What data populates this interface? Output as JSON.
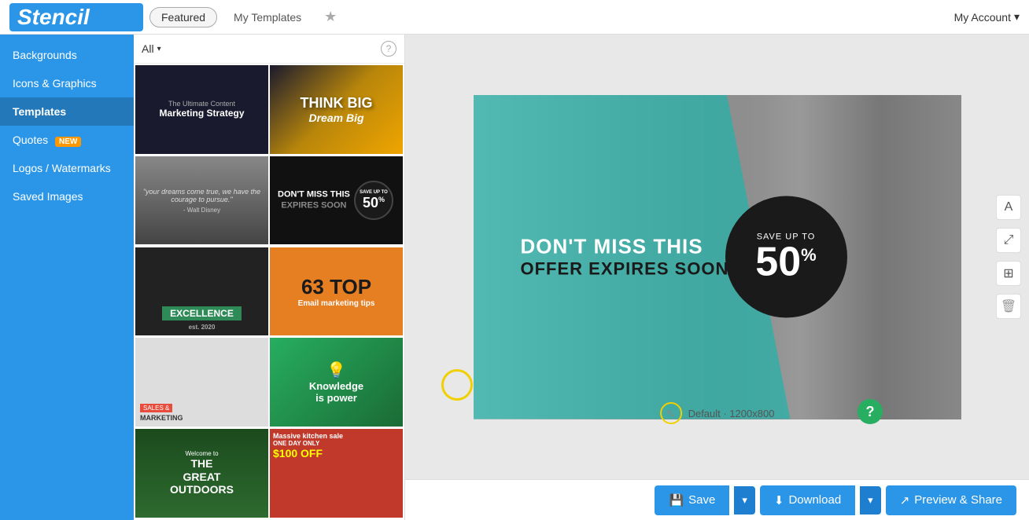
{
  "app": {
    "logo": "Stencil",
    "myAccount": "My Account"
  },
  "topTabs": {
    "featured": "Featured",
    "myTemplates": "My Templates"
  },
  "sidebar": {
    "items": [
      {
        "id": "backgrounds",
        "label": "Backgrounds",
        "badge": null
      },
      {
        "id": "icons-graphics",
        "label": "Icons & Graphics",
        "badge": null
      },
      {
        "id": "templates",
        "label": "Templates",
        "badge": null
      },
      {
        "id": "quotes",
        "label": "Quotes",
        "badge": "NEW"
      },
      {
        "id": "logos-watermarks",
        "label": "Logos / Watermarks",
        "badge": null
      },
      {
        "id": "saved-images",
        "label": "Saved Images",
        "badge": null
      }
    ]
  },
  "panel": {
    "filterLabel": "All",
    "templates": [
      {
        "id": 1,
        "label": "The Ultimate Content Marketing Strategy"
      },
      {
        "id": 2,
        "label": "THINK BIG Dream Big"
      },
      {
        "id": 3,
        "label": "Walt Disney quote"
      },
      {
        "id": 4,
        "label": "Don't Miss This Expires Soon 50%"
      },
      {
        "id": 5,
        "label": "Excellence"
      },
      {
        "id": 6,
        "label": "63 TOP Email marketing tips"
      },
      {
        "id": 7,
        "label": "Sales & Marketing Course"
      },
      {
        "id": 8,
        "label": "Knowledge is power"
      },
      {
        "id": 9,
        "label": "Welcome to the Great Outdoors"
      },
      {
        "id": 10,
        "label": "Massive kitchen sale ONE DAY ONLY"
      }
    ]
  },
  "canvas": {
    "mainTextLine1": "DON'T MISS THIS",
    "mainTextLine2": "OFFER EXPIRES SOON",
    "saveUpTo": "SAVE UP TO",
    "percent": "50",
    "percentSymbol": "%",
    "sizeLabel": "Default · 1200x800"
  },
  "bottomToolbar": {
    "saveLabel": "Save",
    "downloadLabel": "Download",
    "previewLabel": "Preview & Share"
  },
  "icons": {
    "star": "★",
    "chevronDown": "▾",
    "help": "?",
    "text": "A",
    "expand": "⤢",
    "grid": "⊞",
    "trash": "🗑",
    "save": "💾",
    "download": "⬇",
    "share": "↗"
  }
}
